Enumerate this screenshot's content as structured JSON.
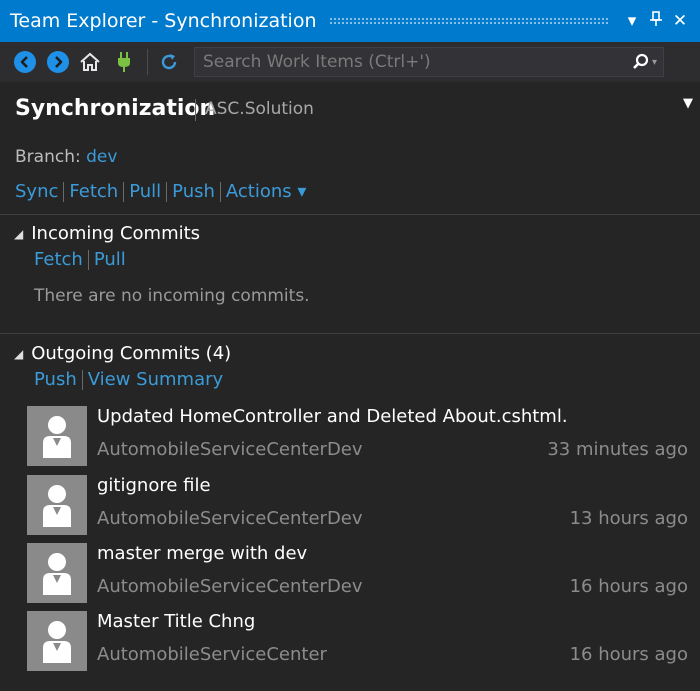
{
  "window": {
    "title": "Team Explorer - Synchronization",
    "dropdown_glyph": "▾",
    "pin_glyph": "⊥",
    "close_glyph": "✕"
  },
  "toolbar": {
    "back_icon": "back-arrow-icon",
    "forward_icon": "forward-arrow-icon",
    "home_icon": "home-icon",
    "connect_icon": "plug-icon",
    "refresh_icon": "refresh-icon",
    "search_placeholder": "Search Work Items (Ctrl+')",
    "search_icon": "search-icon"
  },
  "header": {
    "title": "Synchronization",
    "subtitle": "ASC.Solution"
  },
  "branch": {
    "label": "Branch:",
    "name": "dev"
  },
  "actions": {
    "sync": "Sync",
    "fetch": "Fetch",
    "pull": "Pull",
    "push": "Push",
    "more": "Actions ▾"
  },
  "incoming": {
    "title": "Incoming Commits",
    "fetch": "Fetch",
    "pull": "Pull",
    "empty": "There are no incoming commits."
  },
  "outgoing": {
    "title": "Outgoing Commits (4)",
    "push": "Push",
    "view_summary": "View Summary",
    "commits": [
      {
        "message": "Updated HomeController and Deleted About.cshtml.",
        "author": "AutomobileServiceCenterDev",
        "time": "33 minutes ago"
      },
      {
        "message": "gitignore file",
        "author": "AutomobileServiceCenterDev",
        "time": "13 hours ago"
      },
      {
        "message": "master merge with dev",
        "author": "AutomobileServiceCenterDev",
        "time": "16 hours ago"
      },
      {
        "message": "Master Title Chng",
        "author": "AutomobileServiceCenter",
        "time": "16 hours ago"
      }
    ]
  },
  "colors": {
    "accent": "#007acc",
    "link": "#3b9bd8",
    "background": "#252526",
    "toolbar": "#2d2d30"
  }
}
